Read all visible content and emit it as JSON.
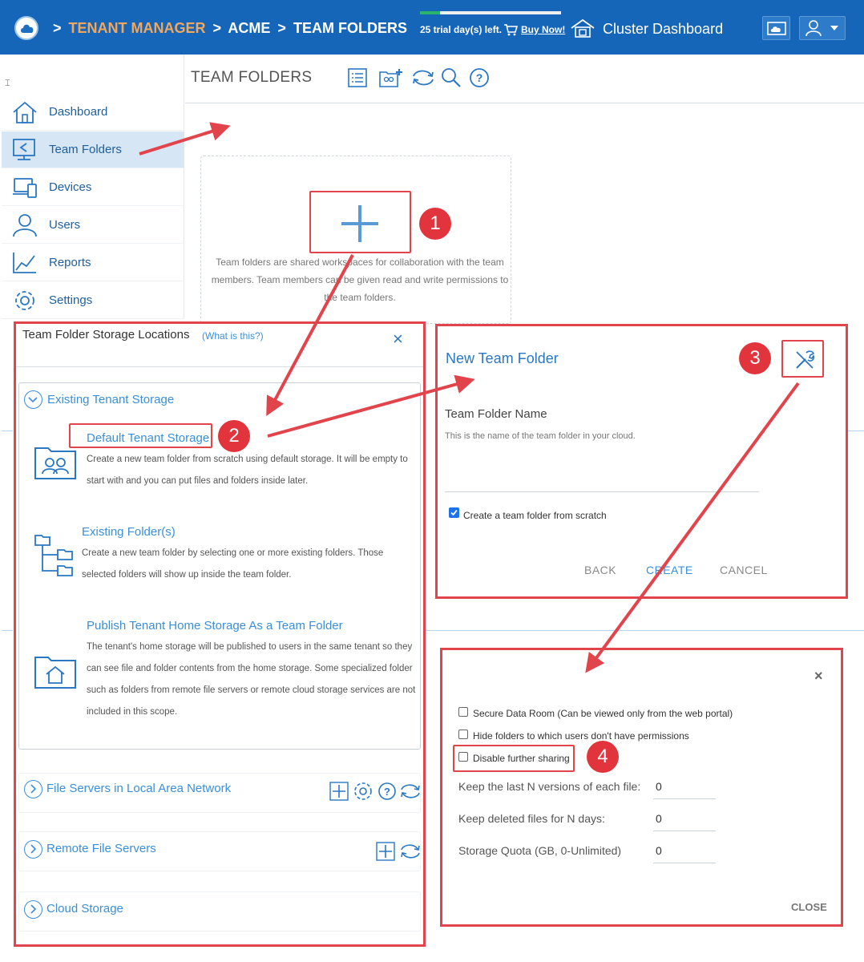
{
  "topbar": {
    "crumb_sep": ">",
    "crumbs": [
      "TENANT MANAGER",
      "ACME",
      "TEAM FOLDERS"
    ],
    "trial_text": "25 trial day(s) left.",
    "trial_progress": 0.14,
    "buy_now": "Buy Now!",
    "cluster_dashboard": "Cluster Dashboard"
  },
  "sidebar": {
    "collapse_glyph": "⌶",
    "items": [
      {
        "label": "Dashboard",
        "icon": "home-icon"
      },
      {
        "label": "Team Folders",
        "icon": "team-folders-icon",
        "active": true
      },
      {
        "label": "Devices",
        "icon": "devices-icon"
      },
      {
        "label": "Users",
        "icon": "users-icon"
      },
      {
        "label": "Reports",
        "icon": "reports-icon"
      },
      {
        "label": "Settings",
        "icon": "gear-icon"
      }
    ]
  },
  "content": {
    "title": "TEAM FOLDERS",
    "empty_text": "Team folders are shared workspaces for collaboration with the team members. Team members can be given read and write permissions to the team folders."
  },
  "badges": [
    "1",
    "2",
    "3",
    "4"
  ],
  "storage_panel": {
    "title": "Team Folder Storage Locations",
    "what_link": "(What is this?)",
    "close_glyph": "×",
    "existing_heading": "Existing Tenant Storage",
    "options": [
      {
        "title": "Default Tenant Storage",
        "desc": "Create a new team folder from scratch using default storage. It will be empty to start with and you can put files and folders inside later."
      },
      {
        "title": "Existing Folder(s)",
        "desc": "Create a new team folder by selecting one or more existing folders. Those selected folders will show up inside the team folder."
      },
      {
        "title": "Publish Tenant Home Storage As a Team Folder",
        "desc": "The tenant's home storage will be published to users in the same tenant so they can see file and folder contents from the home storage. Some specialized folder such as folders from remote file servers or remote cloud storage services are not included in this scope."
      }
    ],
    "sections": [
      "File Servers in Local Area Network",
      "Remote File Servers",
      "Cloud Storage"
    ]
  },
  "new_folder": {
    "title": "New Team Folder",
    "name_label": "Team Folder Name",
    "name_hint": "This is the name of the team folder in your cloud.",
    "scratch_label": "Create a team folder from scratch",
    "scratch_checked": true,
    "back": "BACK",
    "create": "CREATE",
    "cancel": "CANCEL"
  },
  "advanced": {
    "close_glyph": "×",
    "checks": [
      {
        "label": "Secure Data Room (Can be viewed only from the web portal)",
        "checked": false
      },
      {
        "label": "Hide folders to which users don't have permissions",
        "checked": false
      },
      {
        "label": "Disable further sharing",
        "checked": false
      }
    ],
    "fields": [
      {
        "label": "Keep the last N versions of each file:",
        "value": "0"
      },
      {
        "label": "Keep deleted files for N days:",
        "value": "0"
      },
      {
        "label": "Storage Quota (GB, 0-Unlimited)",
        "value": "0"
      }
    ],
    "close_button": "CLOSE"
  },
  "colors": {
    "topbar": "#1565b8",
    "accent": "#3b8fd8",
    "annotation": "#e2444c"
  }
}
